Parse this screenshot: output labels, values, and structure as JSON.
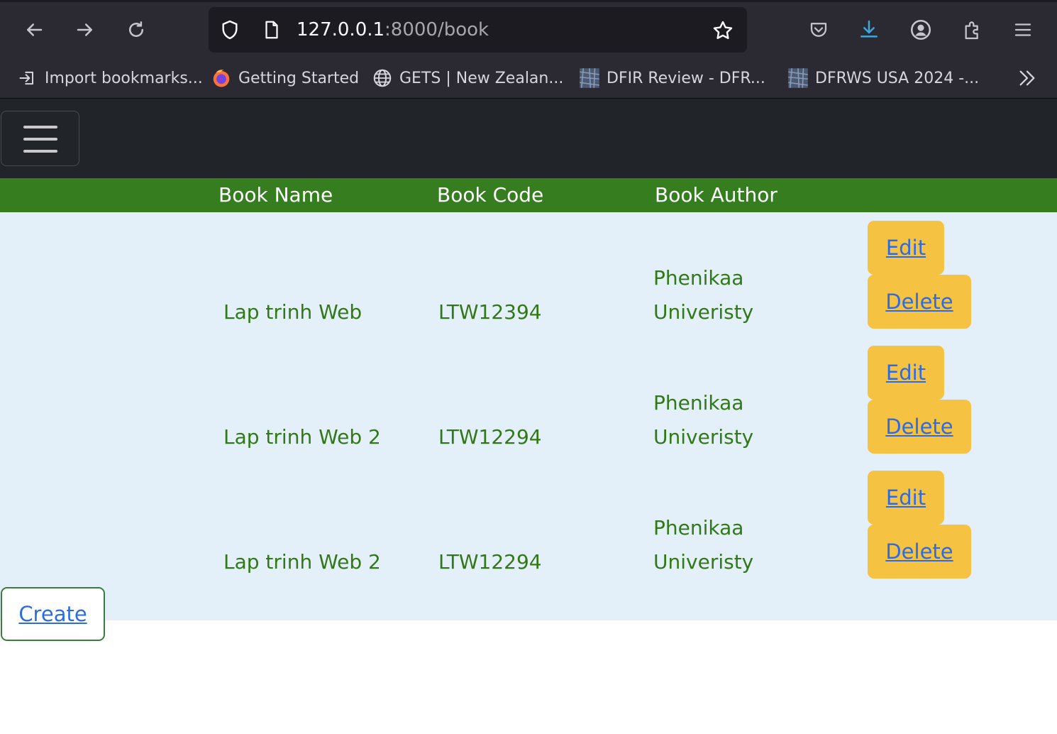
{
  "browser": {
    "url_host": "127.0.0.1",
    "url_path": ":8000/book",
    "icons": {
      "back": "arrow-left-icon",
      "forward": "arrow-right-icon",
      "reload": "reload-icon",
      "security": "shield-icon",
      "page": "page-icon",
      "bookmark_star": "star-icon",
      "pocket": "pocket-icon",
      "downloads": "download-icon",
      "account": "account-icon",
      "extensions": "puzzle-icon",
      "menu": "hamburger-icon"
    },
    "bookmarks": [
      {
        "label": "Import bookmarks...",
        "icon": "import-icon"
      },
      {
        "label": "Getting Started",
        "icon": "firefox-icon"
      },
      {
        "label": "GETS | New Zealan...",
        "icon": "globe-icon"
      },
      {
        "label": "DFIR Review - DFR...",
        "icon": "site-icon"
      },
      {
        "label": "DFRWS USA 2024 -...",
        "icon": "site-icon"
      }
    ]
  },
  "app": {
    "navbar_toggler_icon": "hamburger-icon",
    "table": {
      "headers": [
        "Book Name",
        "Book Code",
        "Book Author"
      ],
      "rows": [
        {
          "name": "Lap trinh Web",
          "code": "LTW12394",
          "author_line1": "Phenikaa",
          "author_line2": "Univeristy",
          "edit": "Edit",
          "delete": "Delete"
        },
        {
          "name": "Lap trinh Web 2",
          "code": "LTW12294",
          "author_line1": "Phenikaa",
          "author_line2": "Univeristy",
          "edit": "Edit",
          "delete": "Delete"
        },
        {
          "name": "Lap trinh Web 2",
          "code": "LTW12294",
          "author_line1": "Phenikaa",
          "author_line2": "Univeristy",
          "edit": "Edit",
          "delete": "Delete"
        }
      ]
    },
    "create_label": "Create"
  },
  "colors": {
    "header_green": "#367d20",
    "text_green": "#317817",
    "row_bg": "#e3f0fa",
    "button_yellow": "#f5c242",
    "link_blue": "#2e6be2",
    "navbar_dark": "#212529"
  }
}
